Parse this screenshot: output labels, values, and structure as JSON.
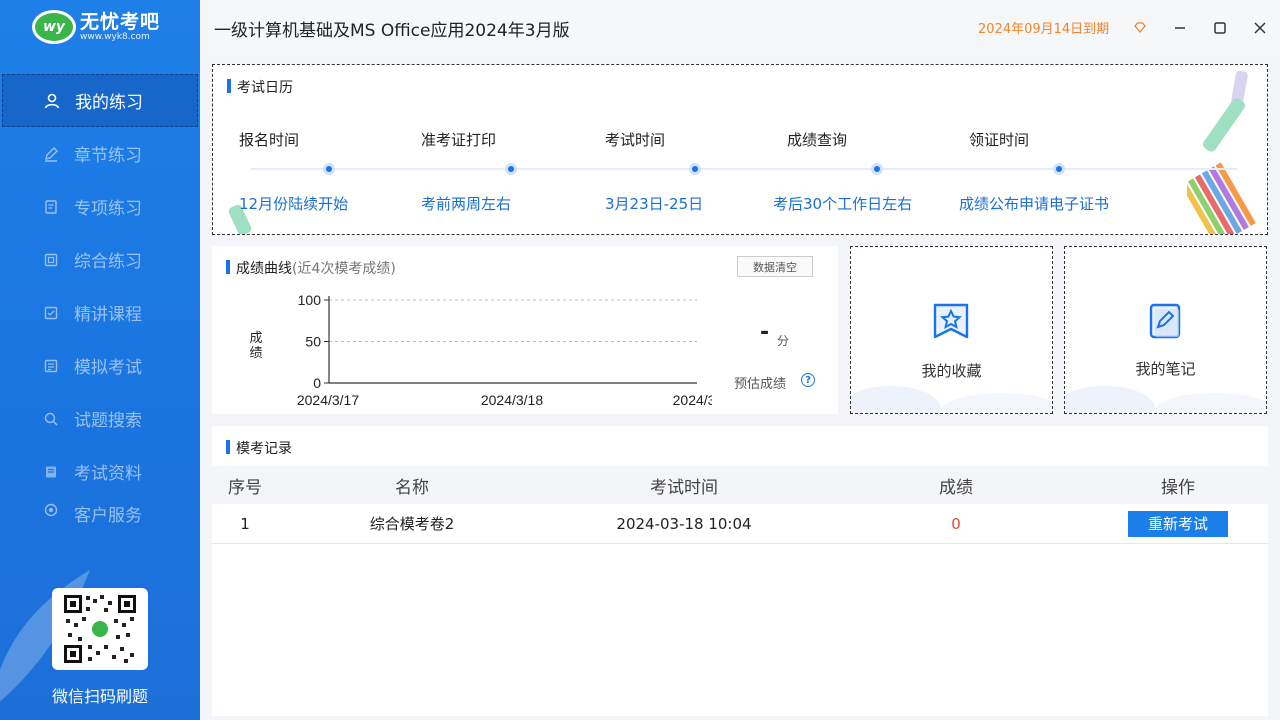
{
  "sidebar": {
    "logo": {
      "name": "无忧考吧",
      "url": "www.wyk8.com",
      "badge": "wy"
    },
    "items": [
      {
        "label": "我的练习",
        "icon": "user-icon"
      },
      {
        "label": "章节练习",
        "icon": "pencil-icon"
      },
      {
        "label": "专项练习",
        "icon": "document-icon"
      },
      {
        "label": "综合练习",
        "icon": "layers-icon"
      },
      {
        "label": "精讲课程",
        "icon": "course-icon"
      },
      {
        "label": "模拟考试",
        "icon": "exam-icon"
      },
      {
        "label": "试题搜索",
        "icon": "search-icon"
      },
      {
        "label": "考试资料",
        "icon": "book-icon"
      },
      {
        "label": "客户服务",
        "icon": "service-icon"
      }
    ],
    "qr_caption": "微信扫码刷题"
  },
  "titlebar": {
    "title": "一级计算机基础及MS Office应用2024年3月版",
    "expire": "2024年09月14日到期"
  },
  "calendar": {
    "title": "考试日历",
    "steps": [
      {
        "label": "报名时间",
        "value": "12月份陆续开始"
      },
      {
        "label": "准考证打印",
        "value": "考前两周左右"
      },
      {
        "label": "考试时间",
        "value": "3月23日-25日"
      },
      {
        "label": "成绩查询",
        "value": "考后30个工作日左右"
      },
      {
        "label": "领证时间",
        "value": "成绩公布申请电子证书"
      }
    ]
  },
  "score_chart": {
    "title": "成绩曲线",
    "subtitle": "(近4次模考成绩)",
    "clear_button": "数据清空",
    "score_value": "-",
    "score_unit": "分",
    "estimate_label": "预估成绩",
    "help": "?"
  },
  "chart_data": {
    "type": "line",
    "x": [
      "2024/3/17",
      "2024/3/18",
      "2024/3/"
    ],
    "series": [],
    "ylabel": "成绩",
    "ylim": [
      0,
      100
    ],
    "yticks": [
      0,
      50,
      100
    ],
    "grid": true
  },
  "cards": {
    "favorites": "我的收藏",
    "notes": "我的笔记"
  },
  "records": {
    "title": "模考记录",
    "columns": [
      "序号",
      "名称",
      "考试时间",
      "成绩",
      "操作"
    ],
    "rows": [
      {
        "index": "1",
        "name": "综合模考卷2",
        "time": "2024-03-18 10:04",
        "score": "0",
        "action": "重新考试"
      }
    ],
    "score_color": "#e8433a"
  },
  "colors": {
    "accent": "#1a73e8",
    "expire": "#f0852d",
    "sidebar": "#1f7fe8"
  }
}
